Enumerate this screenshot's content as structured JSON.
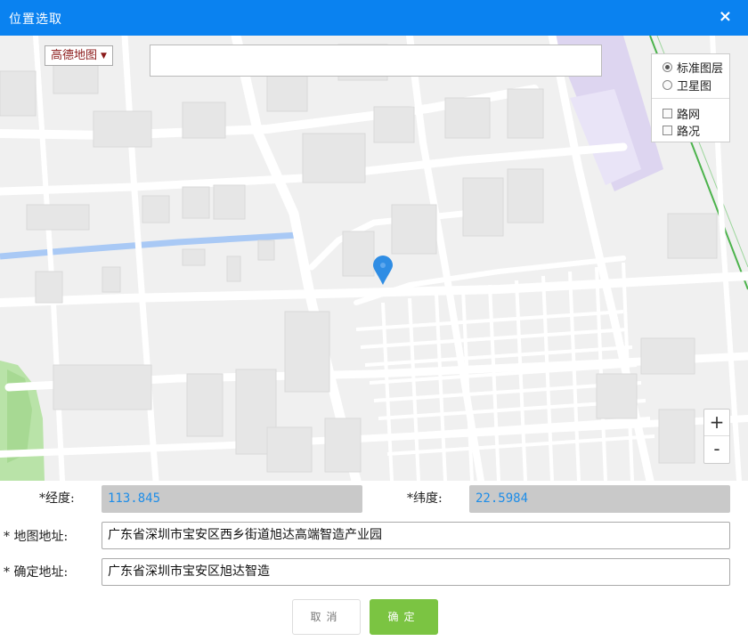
{
  "window": {
    "title": "位置选取",
    "close_glyph": "×"
  },
  "map": {
    "provider_select": "高德地图",
    "search": {
      "value": "",
      "placeholder": ""
    },
    "layers": {
      "standard": "标准图层",
      "satellite": "卫星图",
      "selected": "standard",
      "roads": "路网",
      "traffic": "路况"
    },
    "zoom_in": "+",
    "zoom_out": "-",
    "marker_color": "#2f8de4"
  },
  "form": {
    "lng_label": "*经度:",
    "lng_value": "113.845",
    "lat_label": "*纬度:",
    "lat_value": "22.5984",
    "map_address_label": "* 地图地址:",
    "map_address_value": "广东省深圳市宝安区西乡街道旭达高端智造产业园",
    "confirm_address_label": "* 确定地址:",
    "confirm_address_value": "广东省深圳市宝安区旭达智造"
  },
  "buttons": {
    "cancel": "取消",
    "ok": "确定"
  },
  "colors": {
    "titlebar": "#0a82f0",
    "ok_button": "#7bc442",
    "readonly_text": "#1e8de8"
  }
}
